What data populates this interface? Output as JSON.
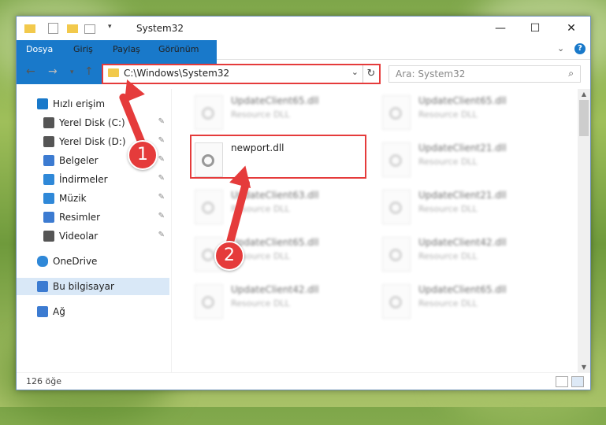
{
  "window": {
    "title": "System32"
  },
  "ribbon": {
    "tabs": [
      {
        "label": "Dosya"
      },
      {
        "label": "Giriş"
      },
      {
        "label": "Paylaş"
      },
      {
        "label": "Görünüm"
      }
    ]
  },
  "navigation": {
    "address": "C:\\Windows\\System32",
    "search_placeholder": "Ara: System32"
  },
  "sidebar": {
    "items": [
      {
        "label": "Hızlı erişim",
        "icon": "star-icon"
      },
      {
        "label": "Yerel Disk (C:)",
        "icon": "drive-icon",
        "pinned": true
      },
      {
        "label": "Yerel Disk (D:)",
        "icon": "drive-icon",
        "pinned": true
      },
      {
        "label": "Belgeler",
        "icon": "documents-icon",
        "pinned": true
      },
      {
        "label": "İndirmeler",
        "icon": "download-icon",
        "pinned": true
      },
      {
        "label": "Müzik",
        "icon": "music-icon",
        "pinned": true
      },
      {
        "label": "Resimler",
        "icon": "pictures-icon",
        "pinned": true
      },
      {
        "label": "Videolar",
        "icon": "video-icon",
        "pinned": true
      },
      {
        "label": "OneDrive",
        "icon": "cloud-icon"
      },
      {
        "label": "Bu bilgisayar",
        "icon": "computer-icon",
        "selected": true
      },
      {
        "label": "Ağ",
        "icon": "network-icon"
      }
    ]
  },
  "files": [
    {
      "name": "UpdateClient65.dll",
      "type": "Resource DLL"
    },
    {
      "name": "UpdateClient65.dll",
      "type": "Resource DLL"
    },
    {
      "name": "newport.dll",
      "type": "",
      "highlighted": true
    },
    {
      "name": "UpdateClient21.dll",
      "type": "Resource DLL"
    },
    {
      "name": "UpdateClient63.dll",
      "type": "Resource DLL"
    },
    {
      "name": "UpdateClient21.dll",
      "type": "Resource DLL"
    },
    {
      "name": "UpdateClient65.dll",
      "type": "Resource DLL"
    },
    {
      "name": "UpdateClient42.dll",
      "type": "Resource DLL"
    },
    {
      "name": "UpdateClient42.dll",
      "type": "Resource DLL"
    },
    {
      "name": "UpdateClient65.dll",
      "type": "Resource DLL"
    }
  ],
  "status": {
    "item_count": "126 öğe"
  },
  "annotations": {
    "step1": "1",
    "step2": "2",
    "accent_color": "#e53b3b"
  }
}
